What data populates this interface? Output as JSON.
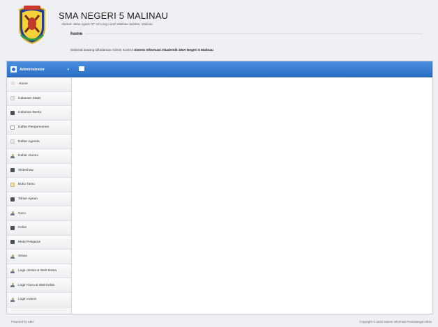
{
  "header": {
    "school_name": "SMA NEGERI 5 MALINAU",
    "address": "Alamat: Jalan Agatis RT VII Long Loreh Malinau Selatan, Malinau"
  },
  "topbar": {
    "admin_label": "Administrator",
    "caret": "▾"
  },
  "sidebar": {
    "items": [
      {
        "label": "Home",
        "icon": "home-icon"
      },
      {
        "label": "Halaman Statis",
        "icon": "document-icon"
      },
      {
        "label": "Halaman Berita",
        "icon": "newspaper-icon"
      },
      {
        "label": "Daftar Pengumuman",
        "icon": "list-icon"
      },
      {
        "label": "Daftar Agenda",
        "icon": "document-icon"
      },
      {
        "label": "Daftar Alumni",
        "icon": "user-icon"
      },
      {
        "label": "Slideshow",
        "icon": "image-icon"
      },
      {
        "label": "Buku Tamu",
        "icon": "book-icon"
      },
      {
        "label": "Tahun Ajaran",
        "icon": "calendar-icon"
      },
      {
        "label": "Guru",
        "icon": "user-icon"
      },
      {
        "label": "Kelas",
        "icon": "class-icon"
      },
      {
        "label": "Mata Pelajaran",
        "icon": "subject-icon"
      },
      {
        "label": "Siswa",
        "icon": "user-icon"
      },
      {
        "label": "Login Siswa & Wali Siswa",
        "icon": "user-icon"
      },
      {
        "label": "Login Guru & Wali Kelas",
        "icon": "user-icon"
      },
      {
        "label": "Login Admin",
        "icon": "user-icon"
      }
    ]
  },
  "content": {
    "title": "home",
    "welcome_prefix": "Selamat Datang Dihalaman Admin Kontrol",
    "welcome_bold": "Sistem Informasi Akademik SMA Negeri 5 Malinau"
  },
  "footer": {
    "left": "Powered by SMT",
    "right": "Copyright © 2015 Sistem Informasi Pemasangan Iklan"
  },
  "colors": {
    "topbar": "#2a6fc6",
    "background": "#eef0f4"
  }
}
